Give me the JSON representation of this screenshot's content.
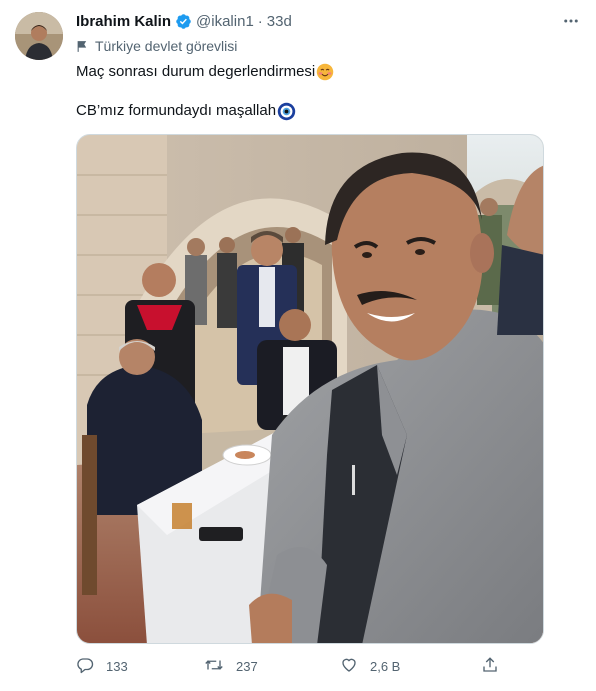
{
  "tweet": {
    "author_name": "Ibrahim Kalin",
    "handle": "@ikalin1",
    "separator": "·",
    "time": "33d",
    "affiliation": "Türkiye devlet görevlisi",
    "text_line1": "Maç sonrası durum degerlendirmesi",
    "text_line2": "CB’mız formundaydı maşallah",
    "emoji_1": "smiling-face-icon",
    "emoji_2": "nazar-amulet-icon"
  },
  "actions": {
    "reply_count": "133",
    "retweet_count": "237",
    "like_count": "2,6 B"
  },
  "colors": {
    "verified": "#1d9bf0",
    "text": "#0f1419",
    "muted": "#536471",
    "border": "#cfd9de"
  }
}
